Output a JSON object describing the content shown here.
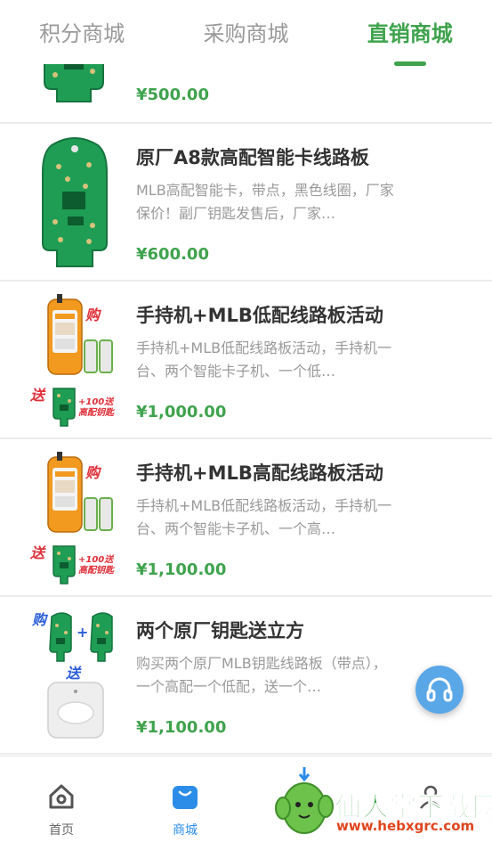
{
  "tabs": [
    {
      "label": "积分商城",
      "active": false
    },
    {
      "label": "采购商城",
      "active": false
    },
    {
      "label": "直销商城",
      "active": true
    }
  ],
  "products": [
    {
      "title": "",
      "desc": "",
      "price": "¥500.00",
      "image": "pcb-board"
    },
    {
      "title": "原厂A8款高配智能卡线路板",
      "desc": "MLB高配智能卡，带点，黑色线圈，厂家保价！副厂钥匙发售后，厂家…",
      "price": "¥600.00",
      "image": "pcb-board"
    },
    {
      "title": "手持机+MLB低配线路板活动",
      "desc": "手持机+MLB低配线路板活动，手持机一台、两个智能卡子机、一个低…",
      "price": "¥1,000.00",
      "image": "handheld-promo",
      "promo": {
        "buy": "购",
        "gift": "送",
        "bonus": "+100送高配钥匙"
      }
    },
    {
      "title": "手持机+MLB高配线路板活动",
      "desc": "手持机+MLB低配线路板活动，手持机一台、两个智能卡子机、一个高…",
      "price": "¥1,100.00",
      "image": "handheld-promo",
      "promo": {
        "buy": "购",
        "gift": "送",
        "bonus": "+100送高配钥匙"
      }
    },
    {
      "title": "两个原厂钥匙送立方",
      "desc": "购买两个原厂MLB钥匙线路板（带点），一个高配一个低配，送一个…",
      "price": "¥1,100.00",
      "image": "cube-promo",
      "promo": {
        "buy": "购",
        "gift": "送",
        "plus": "+"
      }
    }
  ],
  "fab": {
    "icon": "headset-icon"
  },
  "bottom_nav": [
    {
      "label": "首页",
      "icon": "home-icon",
      "active": false
    },
    {
      "label": "商城",
      "icon": "shop-bag-icon",
      "active": true
    },
    {
      "label": "",
      "icon": "cart-icon",
      "active": false
    },
    {
      "label": "",
      "icon": "user-icon",
      "active": false
    }
  ],
  "watermark": {
    "text": "仙人掌下载网",
    "url": "www.hebxgrc.com"
  },
  "colors": {
    "accent": "#3fa34d",
    "nav_active": "#2c8de8",
    "fab": "#5aa7e8",
    "promo_red": "#e0303a"
  }
}
